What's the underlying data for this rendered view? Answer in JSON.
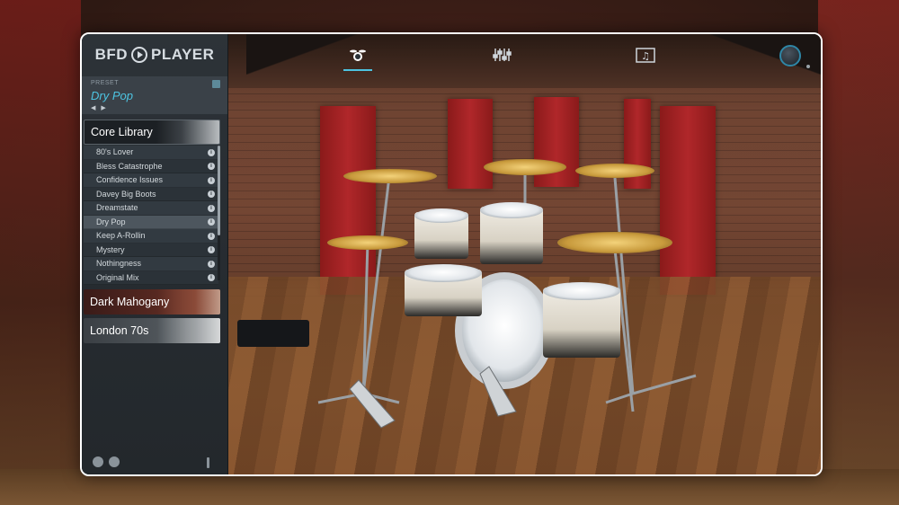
{
  "app": {
    "logo_left": "BFD",
    "logo_right": "PLAYER"
  },
  "preset": {
    "label": "PRESET",
    "name": "Dry Pop",
    "nav": "◀ ▶"
  },
  "library": {
    "core": "Core Library",
    "presets": [
      "80's Lover",
      "Bless Catastrophe",
      "Confidence Issues",
      "Davey Big Boots",
      "Dreamstate",
      "Dry Pop",
      "Keep A-Rollin",
      "Mystery",
      "Nothingness",
      "Original Mix"
    ],
    "selected_index": 5,
    "info_glyph": "i",
    "kits": [
      "Dark Mahogany",
      "London 70s"
    ]
  },
  "tabs": [
    {
      "icon": "drumkit-icon",
      "glyph": "♫"
    },
    {
      "icon": "mixer-icon",
      "glyph": "⫶"
    },
    {
      "icon": "grooves-icon",
      "glyph": "♫"
    }
  ],
  "colors": {
    "accent": "#4dc3e0",
    "panel_red": "#b0272a",
    "sidebar": "#2d3338"
  }
}
